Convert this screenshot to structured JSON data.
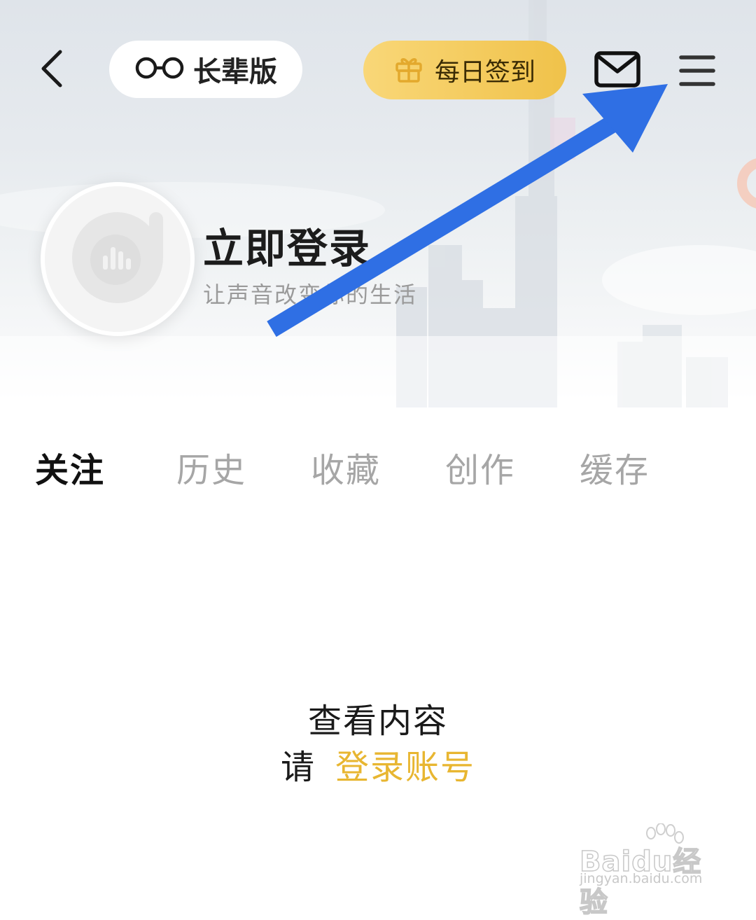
{
  "header": {
    "back_icon": "chevron-left-icon",
    "elder_mode_label": "长辈版",
    "elder_mode_icon": "glasses-icon",
    "checkin_label": "每日签到",
    "checkin_icon": "gift-icon",
    "mail_icon": "mail-icon",
    "menu_icon": "hamburger-menu-icon",
    "checkin_color": "#f0c24a"
  },
  "profile": {
    "login_title": "立即登录",
    "slogan": "让声音改变你的生活"
  },
  "tabs": [
    {
      "label": "关注",
      "active": true
    },
    {
      "label": "历史",
      "active": false
    },
    {
      "label": "收藏",
      "active": false
    },
    {
      "label": "创作",
      "active": false
    },
    {
      "label": "缓存",
      "active": false
    }
  ],
  "empty_state": {
    "line1": "查看内容",
    "prefix": "请",
    "login_link": "登录账号",
    "link_color": "#e8b631"
  },
  "annotation": {
    "arrow_color": "#2f6fe4"
  },
  "watermark": {
    "brand": "Baidu经验",
    "url": "jingyan.baidu.com"
  }
}
